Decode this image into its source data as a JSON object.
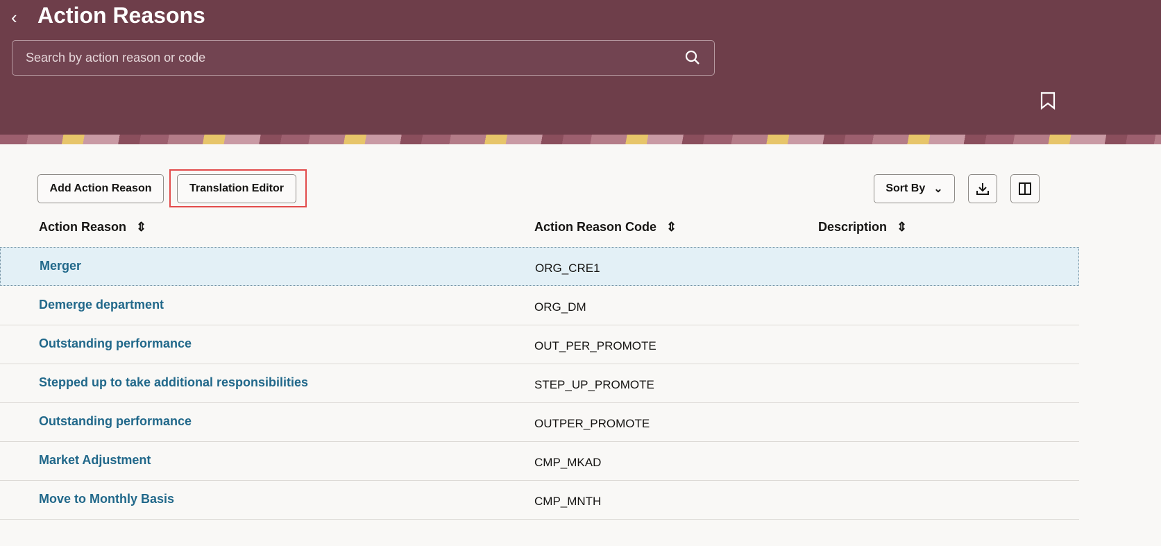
{
  "header": {
    "back_icon": "chevron-left-icon",
    "title": "Action Reasons",
    "search_placeholder": "Search by action reason or code"
  },
  "toolbar": {
    "add_label": "Add Action Reason",
    "translation_label": "Translation Editor",
    "sort_label": "Sort By"
  },
  "table": {
    "columns": [
      "Action Reason",
      "Action Reason Code",
      "Description"
    ],
    "rows": [
      {
        "reason": "Merger",
        "code": "ORG_CRE1"
      },
      {
        "reason": "Demerge department",
        "code": "ORG_DM"
      },
      {
        "reason": "Outstanding performance",
        "code": "OUT_PER_PROMOTE"
      },
      {
        "reason": "Stepped up to take additional responsibilities",
        "code": "STEP_UP_PROMOTE"
      },
      {
        "reason": "Outstanding performance",
        "code": "OUTPER_PROMOTE"
      },
      {
        "reason": "Market Adjustment",
        "code": "CMP_MKAD"
      },
      {
        "reason": "Move to Monthly Basis",
        "code": "CMP_MNTH"
      }
    ]
  }
}
